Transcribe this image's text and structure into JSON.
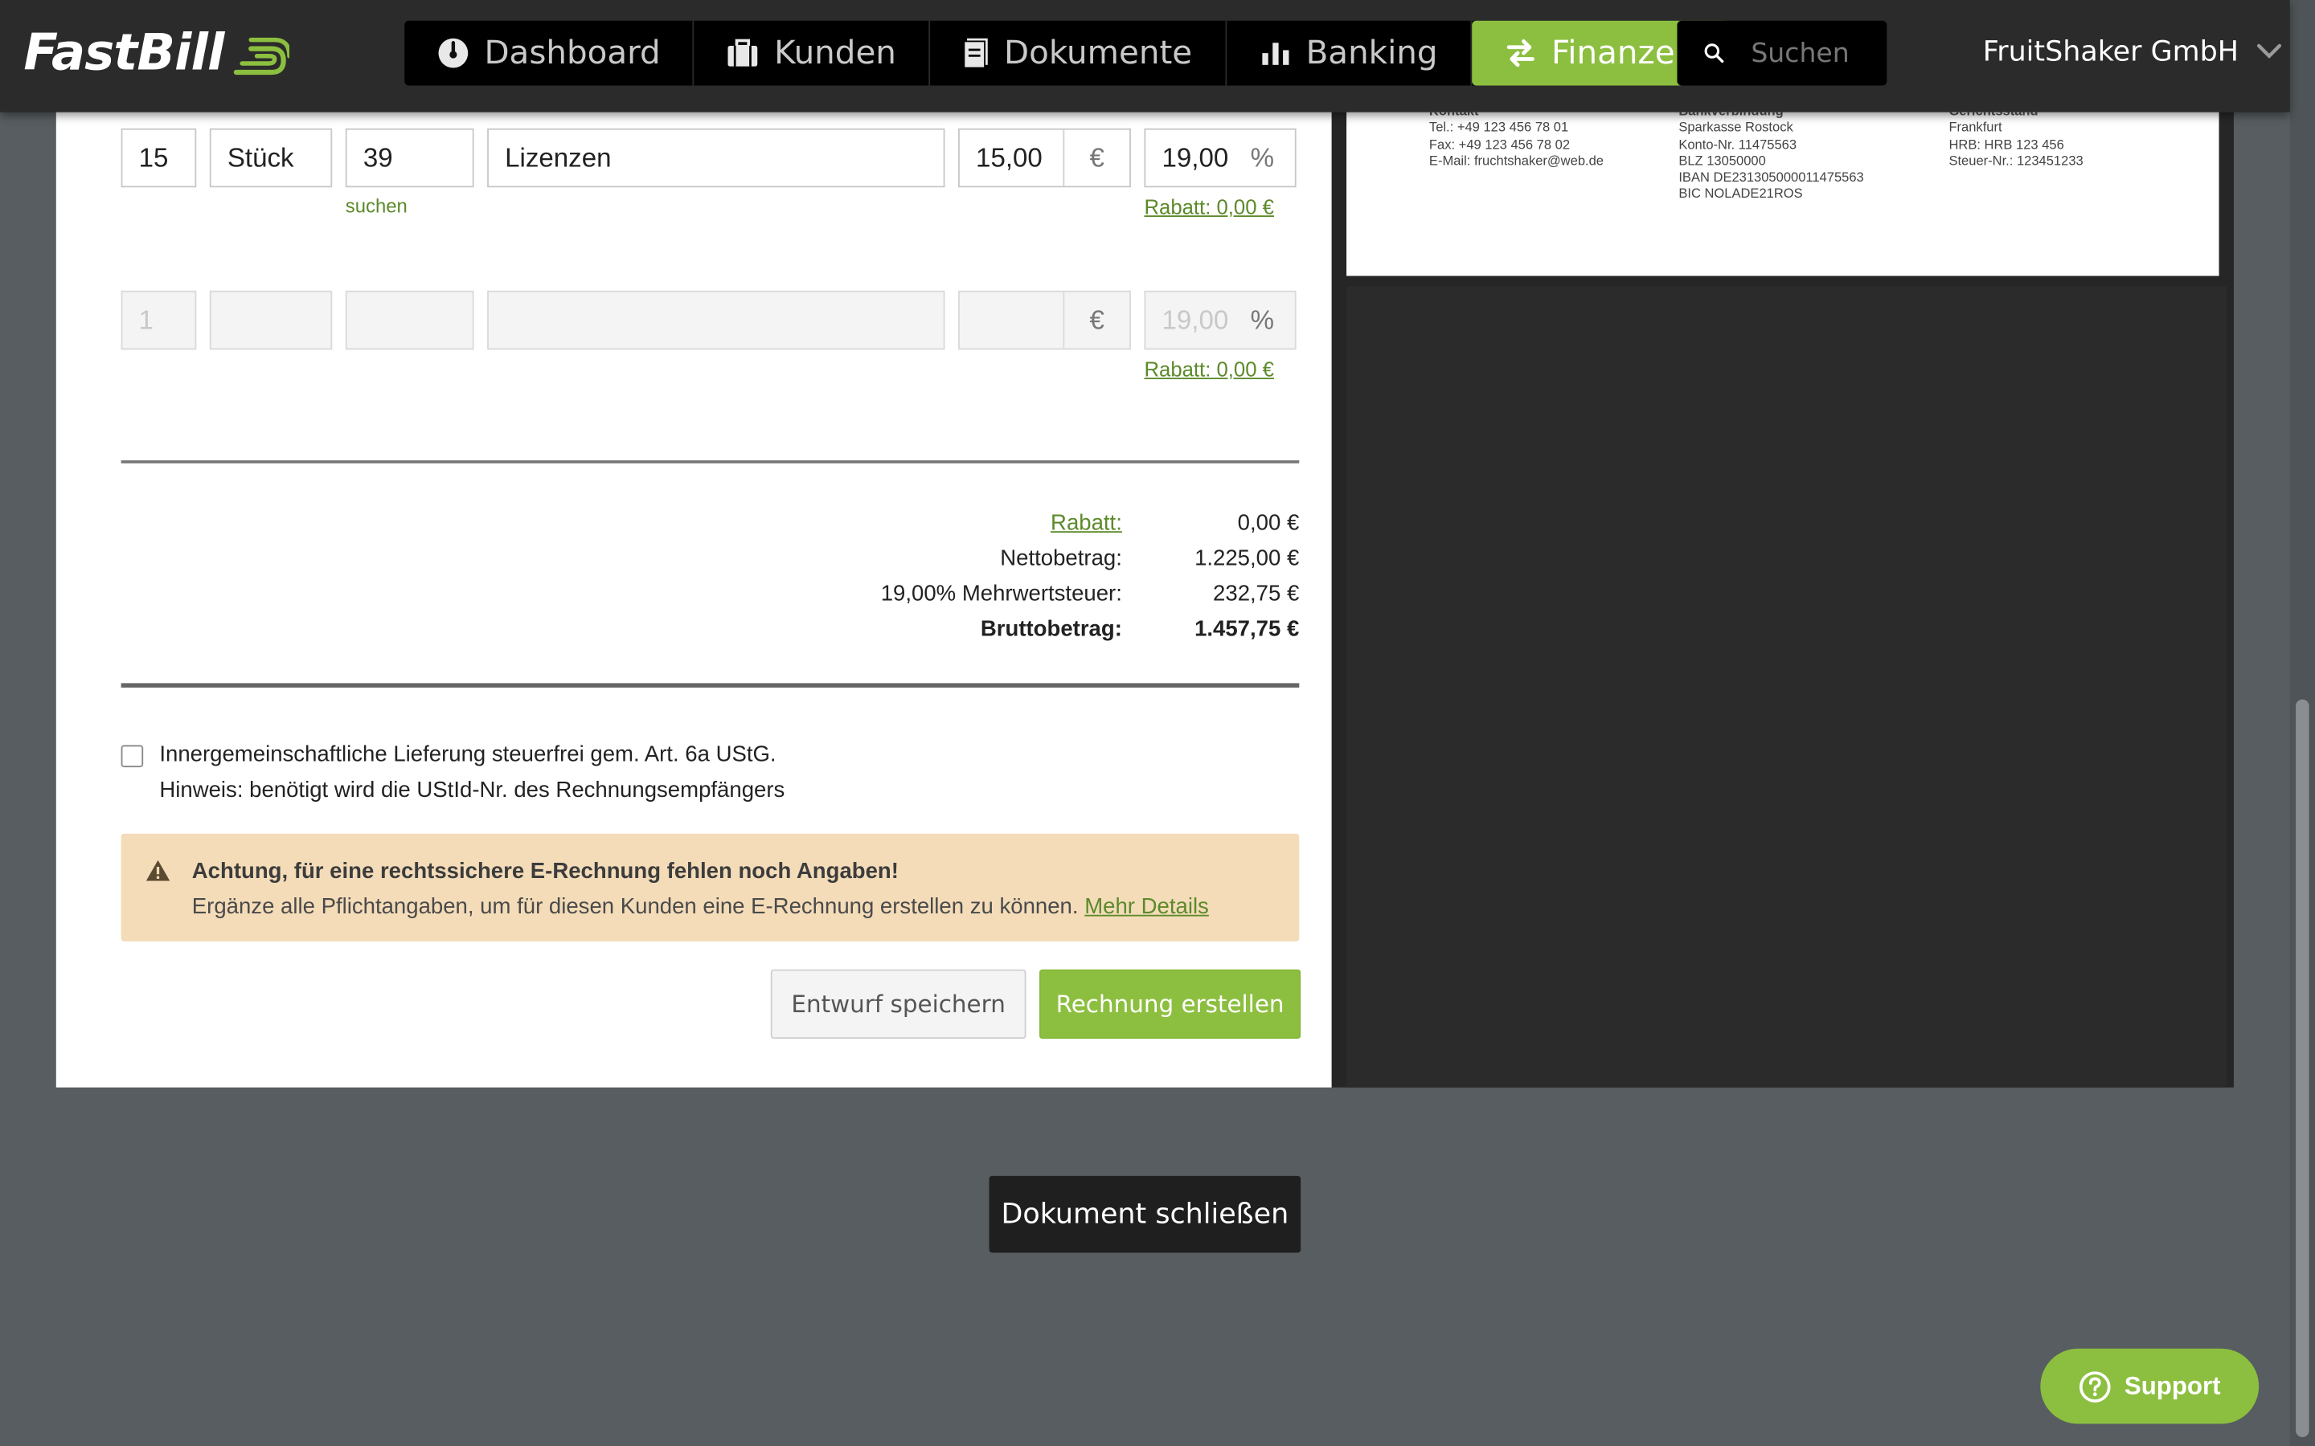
{
  "app": {
    "logo_text": "FastBill",
    "company_name": "FruitShaker GmbH"
  },
  "nav": {
    "items": [
      {
        "label": "Dashboard",
        "icon": "dashboard-gauge-icon"
      },
      {
        "label": "Kunden",
        "icon": "briefcase-icon"
      },
      {
        "label": "Dokumente",
        "icon": "document-icon"
      },
      {
        "label": "Banking",
        "icon": "bar-chart-icon"
      },
      {
        "label": "Finanzen",
        "icon": "transfer-arrows-icon",
        "active": true
      }
    ]
  },
  "search": {
    "placeholder": "Suchen"
  },
  "line_items": [
    {
      "quantity": "15",
      "unit": "Stück",
      "article_no": "39",
      "description": "Lizenzen",
      "price": "15,00",
      "currency": "€",
      "tax": "19,00",
      "percent": "%",
      "search_hint": "suchen",
      "discount_link": "Rabatt: 0,00 €"
    },
    {
      "quantity_placeholder": "1",
      "unit": "",
      "article_no": "",
      "description": "",
      "price": "",
      "currency": "€",
      "tax_placeholder": "19,00",
      "percent": "%",
      "discount_link": "Rabatt: 0,00 €"
    }
  ],
  "totals": {
    "discount_label": "Rabatt:",
    "discount_value": "0,00 €",
    "net_label": "Nettobetrag:",
    "net_value": "1.225,00 €",
    "vat_label": "19,00% Mehrwertsteuer:",
    "vat_value": "232,75 €",
    "gross_label": "Bruttobetrag:",
    "gross_value": "1.457,75 €"
  },
  "intra_community": {
    "checked": false,
    "label": "Innergemeinschaftliche Lieferung steuerfrei gem. Art. 6a UStG.",
    "hint": "Hinweis: benötigt wird die UStId-Nr. des Rechnungsempfängers"
  },
  "alert": {
    "title": "Achtung, für eine rechtssichere E-Rechnung fehlen noch Angaben!",
    "message": "Ergänze alle Pflichtangaben, um für diesen Kunden eine E-Rechnung erstellen zu können.",
    "link": "Mehr Details",
    "color": "#f4dcb9"
  },
  "actions": {
    "save_draft": "Entwurf speichern",
    "create_invoice": "Rechnung erstellen",
    "close_document": "Dokument schließen"
  },
  "support": {
    "label": "Support"
  },
  "preview": {
    "contact": {
      "heading": "Kontakt",
      "lines": [
        "Tel.: +49 123 456 78 01",
        "Fax: +49 123 456 78 02",
        "E-Mail: fruchtshaker@web.de"
      ]
    },
    "bank": {
      "heading": "Bankverbindung",
      "lines": [
        "Sparkasse Rostock",
        "Konto-Nr. 11475563",
        "BLZ 13050000",
        "IBAN DE231305000011475563",
        "BIC NOLADE21ROS"
      ]
    },
    "court": {
      "heading": "Gerichtsstand",
      "lines": [
        "Frankfurt",
        "HRB: HRB 123 456",
        "Steuer-Nr.: 123451233"
      ]
    }
  },
  "colors": {
    "accent": "#8cbf3f",
    "link": "#5c8a2a",
    "topbar": "#2b2b2b",
    "background": "#575d60"
  }
}
